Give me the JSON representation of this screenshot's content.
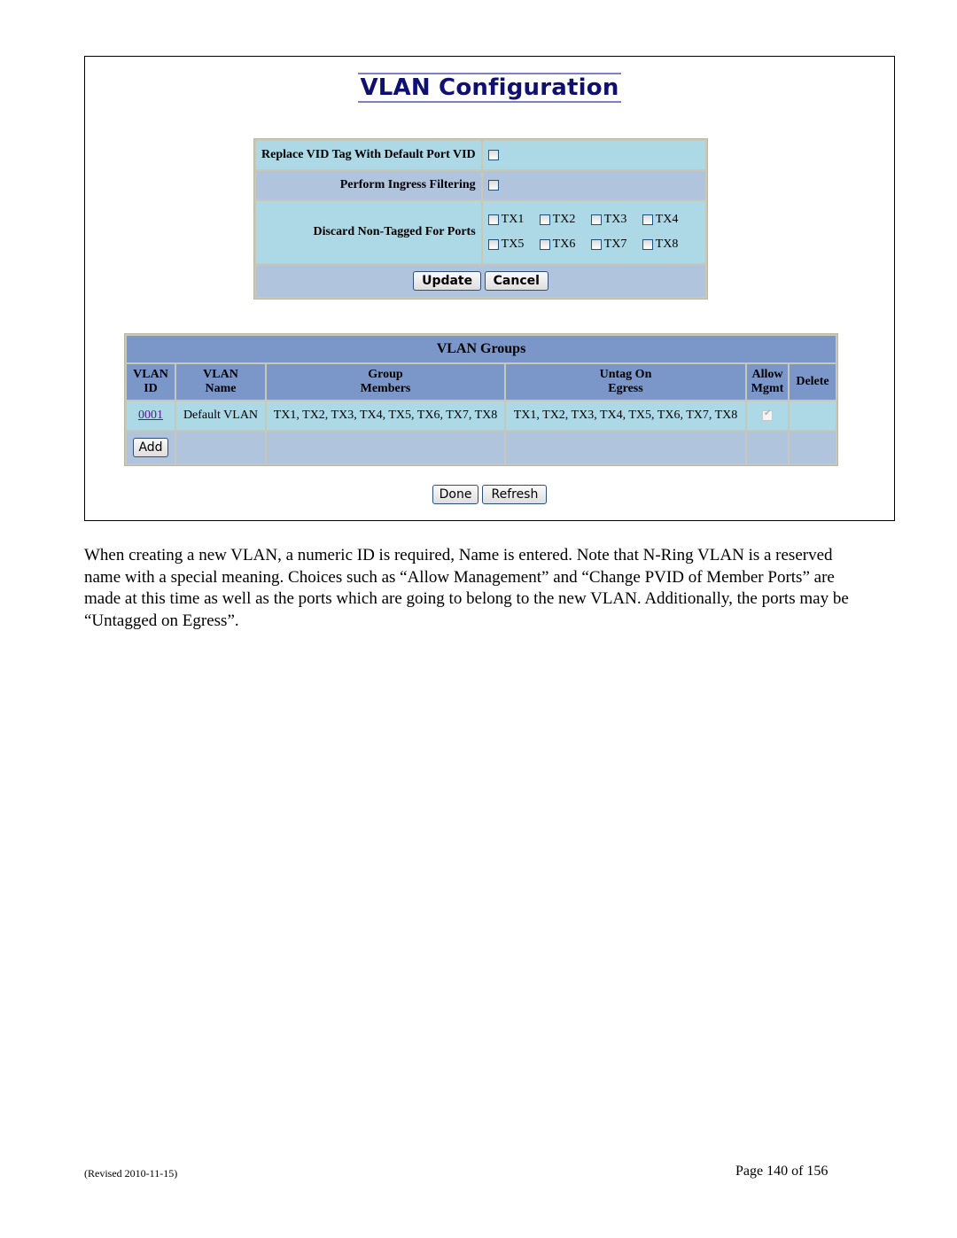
{
  "screenshot": {
    "title": "VLAN Configuration",
    "config": {
      "replace_vid_label": "Replace VID Tag With Default Port VID",
      "ingress_label": "Perform Ingress Filtering",
      "discard_label": "Discard Non-Tagged For Ports",
      "ports": [
        "TX1",
        "TX2",
        "TX3",
        "TX4",
        "TX5",
        "TX6",
        "TX7",
        "TX8"
      ],
      "update_label": "Update",
      "cancel_label": "Cancel"
    },
    "groups": {
      "title": "VLAN Groups",
      "headers": {
        "id_1": "VLAN",
        "id_2": "ID",
        "name_1": "VLAN",
        "name_2": "Name",
        "members_1": "Group",
        "members_2": "Members",
        "untag_1": "Untag On",
        "untag_2": "Egress",
        "mgmt_1": "Allow",
        "mgmt_2": "Mgmt",
        "delete": "Delete"
      },
      "rows": [
        {
          "id": "0001",
          "name": "Default VLAN",
          "members": "TX1, TX2, TX3, TX4, TX5, TX6, TX7, TX8",
          "untag": "TX1, TX2, TX3, TX4, TX5, TX6, TX7, TX8",
          "allow_mgmt": true
        }
      ],
      "add_label": "Add"
    },
    "done_label": "Done",
    "refresh_label": "Refresh"
  },
  "paragraph": "When creating a new VLAN, a numeric ID is required, Name is entered. Note that N-Ring VLAN is a reserved name with a special meaning. Choices such as “Allow Management” and “Change PVID of Member Ports” are made at this time as well as the ports which are going to belong to the new VLAN. Additionally, the ports may be “Untagged on Egress”.",
  "footer": {
    "revised": "(Revised 2010-11-15)",
    "page": "Page 140 of 156"
  }
}
